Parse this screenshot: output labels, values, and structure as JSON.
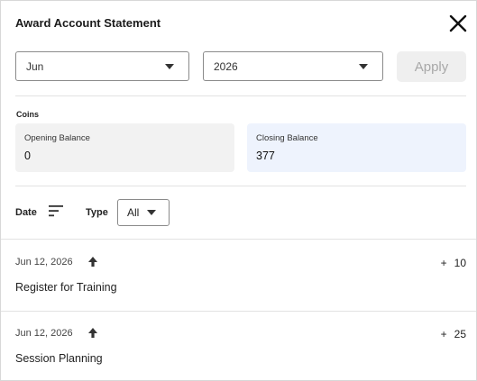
{
  "header": {
    "title": "Award Account Statement"
  },
  "filters": {
    "month": "Jun",
    "year": "2026",
    "apply_label": "Apply"
  },
  "coins": {
    "label": "Coins",
    "opening_label": "Opening Balance",
    "opening_value": "0",
    "closing_label": "Closing Balance",
    "closing_value": "377"
  },
  "list_filters": {
    "date_label": "Date",
    "type_label": "Type",
    "type_value": "All"
  },
  "transactions": [
    {
      "date": "Jun 12, 2026",
      "sign": "+",
      "amount": "10",
      "description": "Register for Training"
    },
    {
      "date": "Jun 12, 2026",
      "sign": "+",
      "amount": "25",
      "description": "Session Planning"
    }
  ],
  "icons": {
    "close": "close-icon",
    "caret": "chevron-down-icon",
    "sort": "sort-icon",
    "direction": "arrow-up-icon"
  }
}
